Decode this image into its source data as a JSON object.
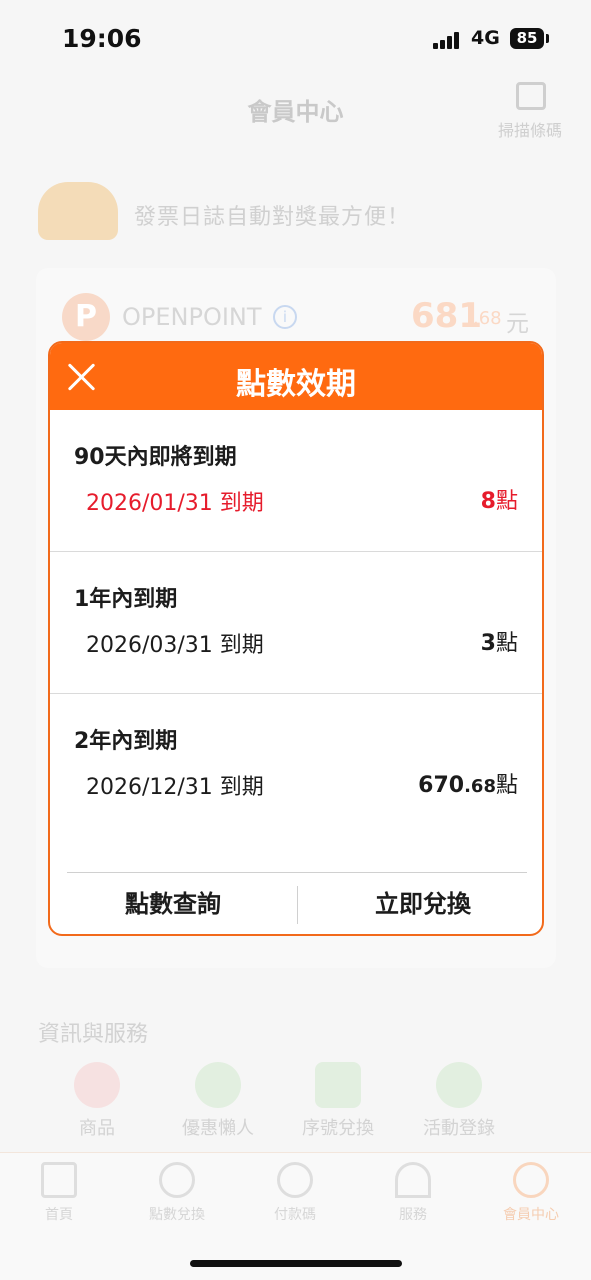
{
  "status_bar": {
    "time": "19:06",
    "network": "4G",
    "battery": "85"
  },
  "background": {
    "header": {
      "title": "會員中心",
      "scan_label": "掃描條碼"
    },
    "banner": {
      "text": "發票日誌自動對獎最方便！"
    },
    "openpoint": {
      "label": "OPENPOINT",
      "value_int": "681",
      "value_dec": ".68",
      "unit": "元"
    },
    "services": {
      "title": "資訊與服務",
      "items": [
        {
          "label": "商品"
        },
        {
          "label": "優惠懶人"
        },
        {
          "label": "序號兌換"
        },
        {
          "label": "活動登錄"
        }
      ]
    },
    "tabbar": {
      "items": [
        {
          "label": "首頁",
          "icon": "home-icon"
        },
        {
          "label": "點數兌換",
          "icon": "points-icon"
        },
        {
          "label": "付款碼",
          "icon": "dollar-icon"
        },
        {
          "label": "服務",
          "icon": "rainbow-icon"
        },
        {
          "label": "會員中心",
          "icon": "member-icon",
          "active": true
        }
      ]
    }
  },
  "modal": {
    "title": "點數效期",
    "groups": [
      {
        "title": "90天內即將到期",
        "date": "2026/01/31 到期",
        "points_int": "8",
        "points_dec": "",
        "unit": "點",
        "highlight": true
      },
      {
        "title": "1年內到期",
        "date": "2026/03/31 到期",
        "points_int": "3",
        "points_dec": "",
        "unit": "點",
        "highlight": false
      },
      {
        "title": "2年內到期",
        "date": "2026/12/31 到期",
        "points_int": "670",
        "points_dec": ".68",
        "unit": "點",
        "highlight": false
      }
    ],
    "footer": {
      "left_label": "點數查詢",
      "right_label": "立即兌換"
    }
  },
  "colors": {
    "accent": "#ff6a10",
    "warning": "#e61c2c"
  }
}
